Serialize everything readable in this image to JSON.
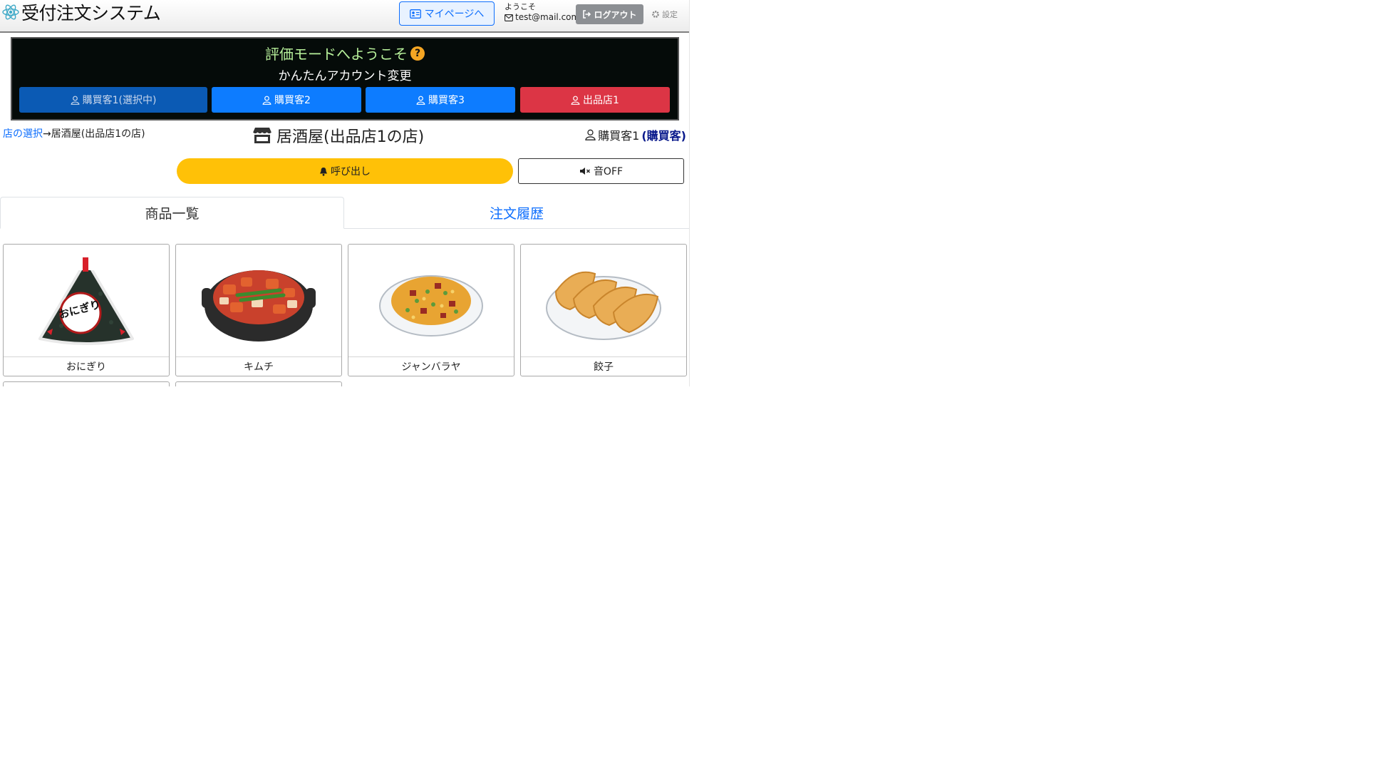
{
  "header": {
    "app_title": "受付注文システム",
    "mypage_label": "マイページへ",
    "welcome_label": "ようこそ",
    "email": "test@mail.com",
    "logout_label": "ログアウト",
    "settings_label": "設定"
  },
  "eval_panel": {
    "title": "評価モードへようこそ",
    "subtitle": "かんたんアカウント変更",
    "accounts": [
      {
        "label": "購買客1(選択中)",
        "color": "#0b5ab4",
        "selected": true
      },
      {
        "label": "購買客2",
        "color": "#0d7cff",
        "selected": false
      },
      {
        "label": "購買客3",
        "color": "#0d7cff",
        "selected": false
      },
      {
        "label": "出品店1",
        "color": "#dc3545",
        "selected": false
      }
    ]
  },
  "breadcrumb": {
    "link": "店の選択",
    "arrow": "→",
    "current": "居酒屋(出品店1の店)"
  },
  "shop_title": "居酒屋(出品店1の店)",
  "user": {
    "name": "購買客1",
    "role": "(購買客)"
  },
  "actions": {
    "call_label": "呼び出し",
    "sound_label": "音OFF",
    "call_color": "#ffc107"
  },
  "tabs": [
    {
      "label": "商品一覧",
      "active": true
    },
    {
      "label": "注文履歴",
      "active": false
    }
  ],
  "products": [
    {
      "name": "おにぎり",
      "icon": "onigiri-image"
    },
    {
      "name": "キムチ",
      "icon": "kimchi-image"
    },
    {
      "name": "ジャンバラヤ",
      "icon": "jambalaya-image"
    },
    {
      "name": "餃子",
      "icon": "gyoza-image"
    }
  ],
  "onigiri_label": "おにぎり"
}
